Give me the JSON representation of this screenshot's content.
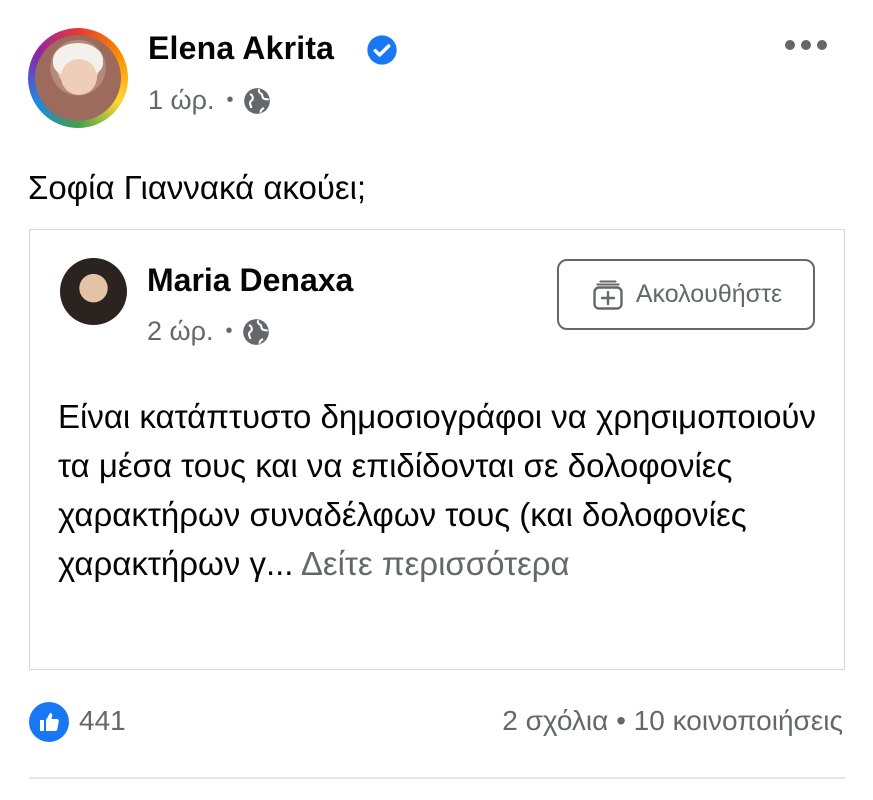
{
  "post": {
    "author": "Elena Akrita",
    "time": "1 ώρ.",
    "separator": "•",
    "text": "Σοφία Γιαννακά ακούει;"
  },
  "shared_post": {
    "author": "Maria Denaxa",
    "time": "2 ώρ.",
    "separator": "•",
    "follow_label": "Ακολουθήστε",
    "text": "Είναι κατάπτυστο δημοσιογράφοι  να χρησιμοποιούν τα μέσα τους και να επιδίδονται σε δολοφονίες χαρακτήρων συναδέλφων τους (και δολοφονίες χαρακτήρων γ...",
    "see_more": "Δείτε περισσότερα"
  },
  "footer": {
    "likes": "441",
    "stats": "2 σχόλια • 10 κοινοποιήσεις"
  },
  "icons": {
    "verified": "verified-badge-icon",
    "audience": "globe-icon",
    "more": "more-options-icon",
    "follow": "follow-icon",
    "like": "like-icon"
  },
  "colors": {
    "accent": "#1877f2",
    "secondary_text": "#65676b"
  }
}
